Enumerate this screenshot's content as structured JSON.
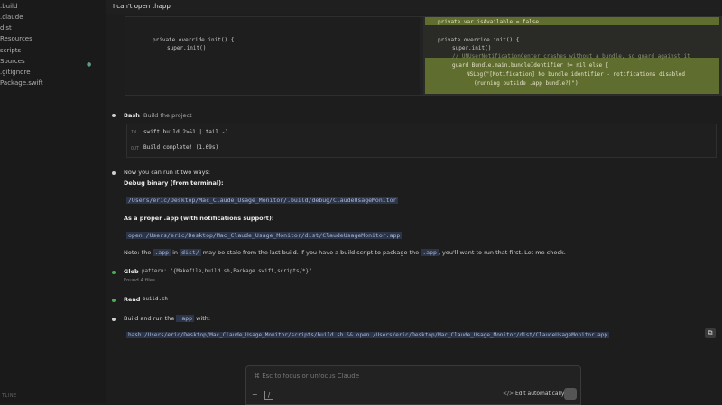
{
  "sidebar": {
    "items": [
      ".build",
      ".claude",
      "dist",
      "Resources",
      "scripts",
      "Sources",
      ".gitignore",
      "Package.swift"
    ],
    "outline_label": "TLINE"
  },
  "query": {
    "text": "I can't open thapp"
  },
  "diff": {
    "left_lines": [
      "private override init() {",
      "super.init()"
    ],
    "right_lines": [
      "private var isAvailable = false",
      "private override init() {",
      "super.init()",
      "// UNUserNotificationCenter crashes without a bundle, so guard against it",
      "guard Bundle.main.bundleIdentifier != nil else {",
      "NSLog(\"[Notification] No bundle identifier - notifications disabled",
      "(running outside .app bundle?)\")"
    ]
  },
  "bash": {
    "tool": "Bash",
    "desc": "Build the project",
    "in_label": "IN",
    "command": "swift build 2>&1 | tail -1",
    "out_label": "OUT",
    "output": "Build complete! (1.69s)"
  },
  "message": {
    "intro": "Now you can run it two ways:",
    "debug_heading": "Debug binary (from terminal):",
    "debug_path": "/Users/eric/Desktop/Mac_Claude_Usage_Monitor/.build/debug/ClaudeUsageMonitor",
    "app_heading": "As a proper .app (with notifications support):",
    "app_cmd": "open /Users/eric/Desktop/Mac_Claude_Usage_Monitor/dist/ClaudeUsageMonitor.app",
    "note_1": "Note: the",
    "note_code_1": ".app",
    "note_2": "in",
    "note_code_2": "dist/",
    "note_3": "may be stale from the last build. If you have a build script to package the",
    "note_code_3": ".app",
    "note_4": ", you'll want to run that first. Let me check."
  },
  "glob": {
    "tool": "Glob",
    "pattern": "pattern: \"{Makefile,build.sh,Package.swift,scripts/*}\"",
    "result": "Found 4 files"
  },
  "read": {
    "tool": "Read",
    "file": "build.sh"
  },
  "final": {
    "text": "Build and run the",
    "code": ".app",
    "text2": "with:",
    "command": "bash /Users/eric/Desktop/Mac_Claude_Usage_Monitor/scripts/build.sh && open /Users/eric/Desktop/Mac_Claude_Usage_Monitor/dist/ClaudeUsageMonitor.app"
  },
  "input": {
    "placeholder": "⌘ Esc to focus or unfocus Claude",
    "mode": "Edit automatically"
  },
  "colors": {
    "accent_green": "#5f6d2f",
    "bullet_green": "#4caf50",
    "bullet_white": "#cfcfcf"
  }
}
